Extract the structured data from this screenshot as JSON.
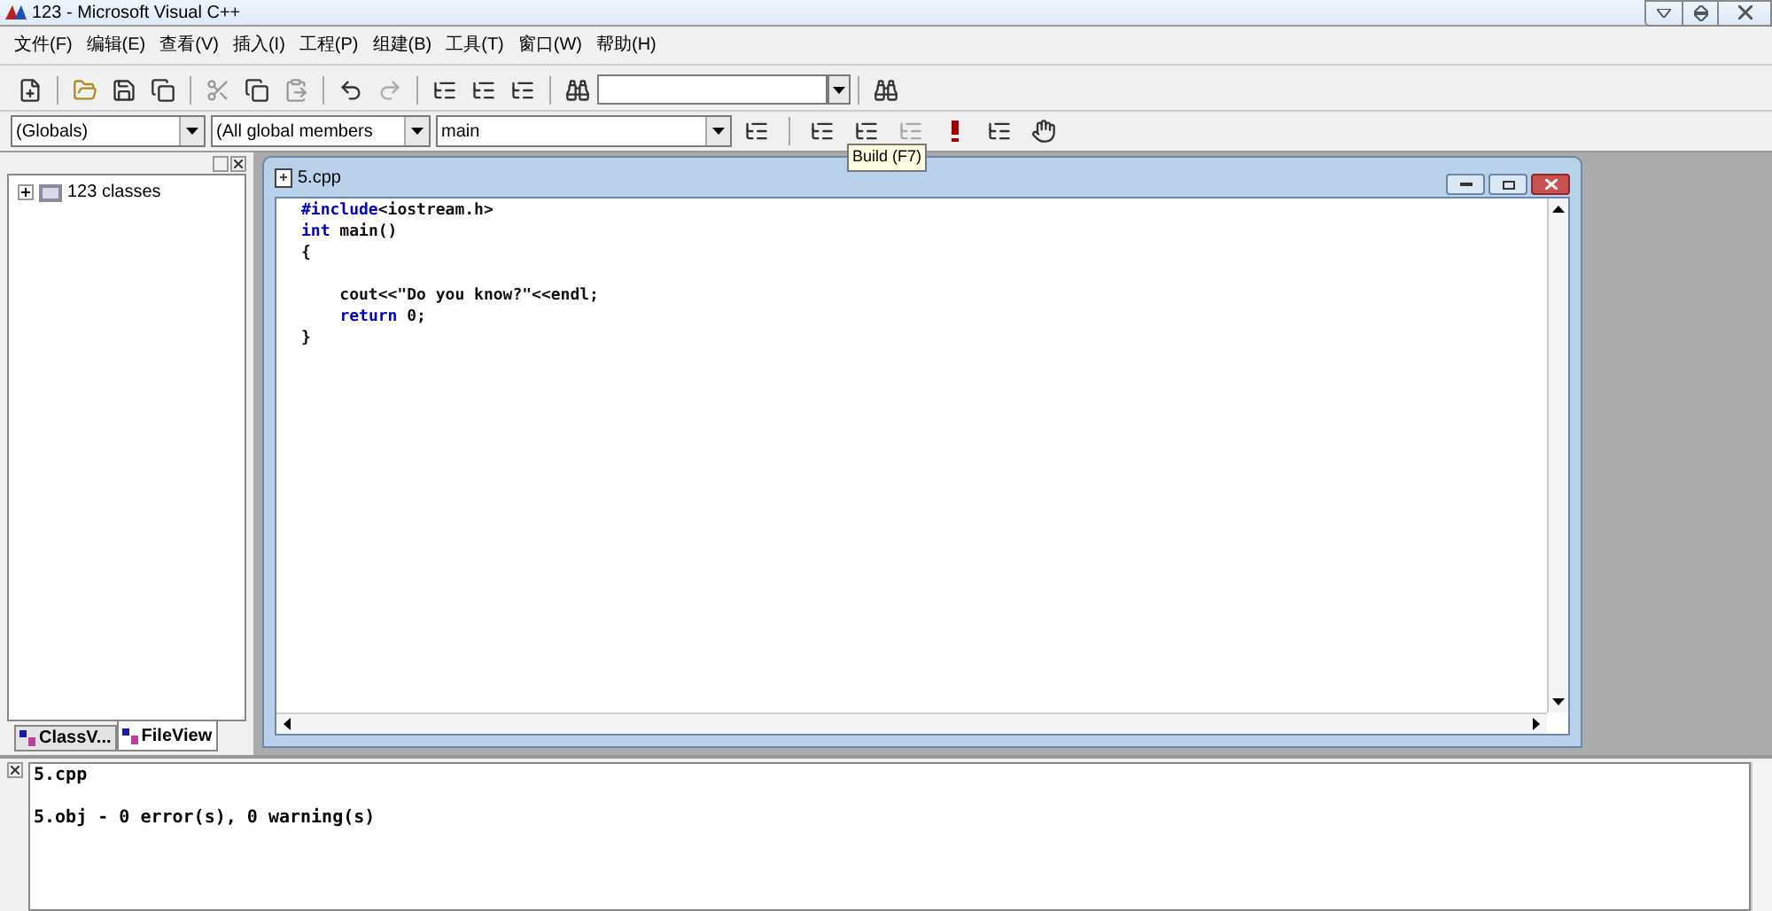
{
  "window": {
    "title": "123 - Microsoft Visual C++"
  },
  "menu": [
    "文件(F)",
    "编辑(E)",
    "查看(V)",
    "插入(I)",
    "工程(P)",
    "组建(B)",
    "工具(T)",
    "窗口(W)",
    "帮助(H)"
  ],
  "wizard_bar": {
    "class_combo": "(Globals)",
    "filter_combo": "(All global members",
    "member_combo": "main"
  },
  "tooltip": "Build (F7)",
  "workspace": {
    "tree": [
      {
        "label": "123 classes",
        "expanded": false
      }
    ],
    "tabs": [
      {
        "label": "ClassV...",
        "selected": false
      },
      {
        "label": "FileView",
        "selected": true
      }
    ]
  },
  "editor": {
    "title": "5.cpp",
    "code": [
      {
        "kind": "keyword",
        "text": "#include"
      },
      {
        "kind": "plain",
        "text": "<iostream.h>\n"
      },
      {
        "kind": "keyword",
        "text": "int"
      },
      {
        "kind": "plain",
        "text": " main()\n{\n\n    cout<<\"Do you know?\"<<endl;\n    "
      },
      {
        "kind": "keyword",
        "text": "return"
      },
      {
        "kind": "plain",
        "text": " 0;\n}"
      }
    ]
  },
  "output": {
    "text": "5.cpp\n\n5.obj - 0 error(s), 0 warning(s)"
  }
}
